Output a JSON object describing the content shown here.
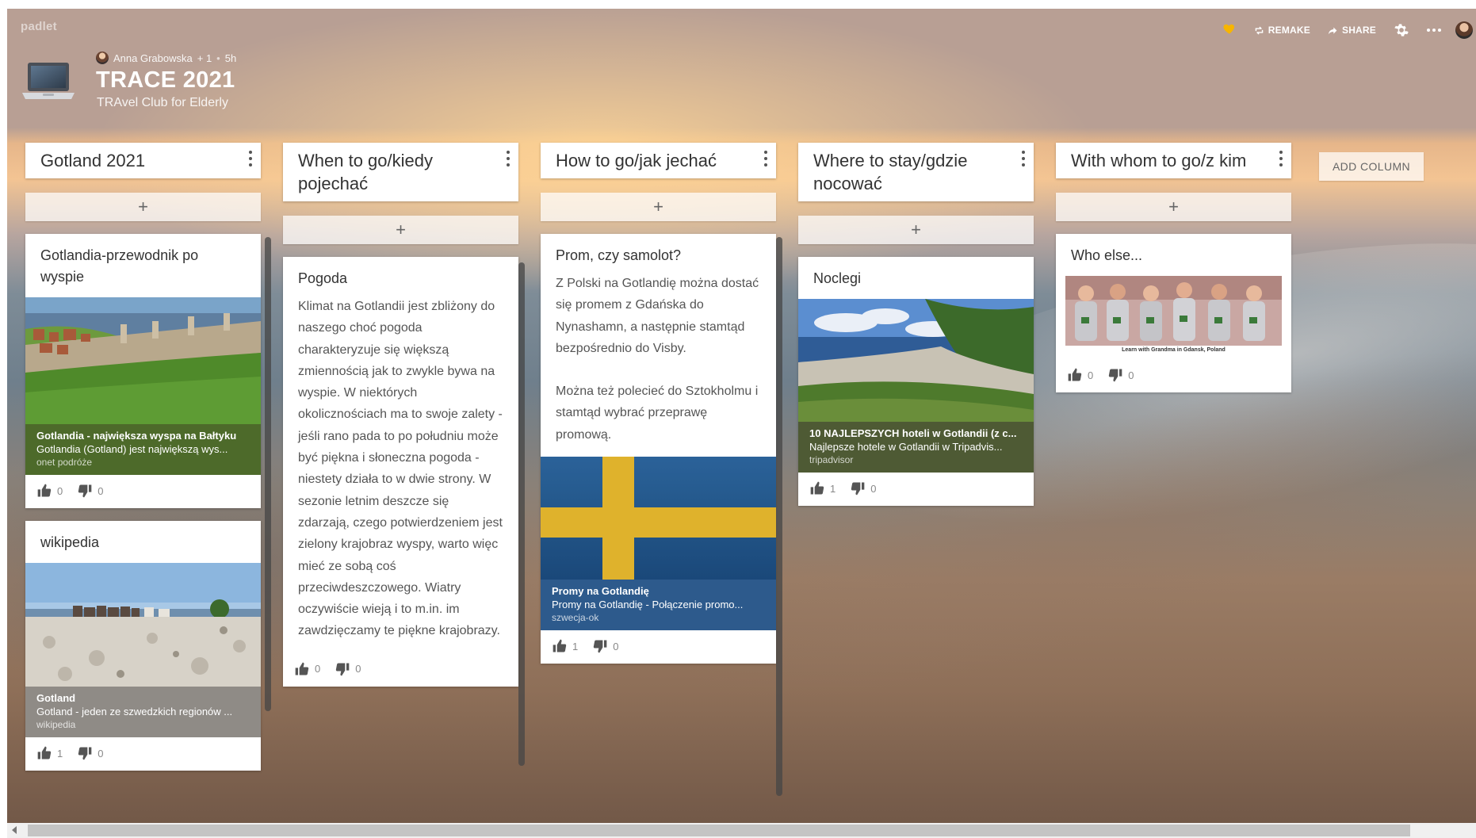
{
  "app": {
    "brand": "padlet",
    "toolbar": {
      "remake_label": "REMAKE",
      "share_label": "SHARE"
    },
    "icons": {
      "favorite": "heart-icon",
      "remake": "remake-icon",
      "share": "share-icon",
      "settings": "gear-icon",
      "more": "more-icon"
    },
    "accent_color": "#f7b500"
  },
  "board": {
    "author": "Anna Grabowska",
    "collaborators": "+ 1",
    "separator": "•",
    "time": "5h",
    "title": "TRACE 2021",
    "subtitle": "TRAvel Club for Elderly",
    "add_column_label": "ADD COLUMN",
    "add_post_label": "+"
  },
  "columns": [
    {
      "title": "Gotland 2021",
      "posts": [
        {
          "title": "Gotlandia-przewodnik po wyspie",
          "attachment": {
            "title": "Gotlandia - największa wyspa na Bałtyku",
            "desc": "Gotlandia (Gotland) jest największą wys...",
            "source": "onet podróże",
            "color": "#4d6a2a"
          },
          "likes": "0",
          "dislikes": "0"
        },
        {
          "title": "wikipedia",
          "attachment": {
            "title": "Gotland",
            "desc": "Gotland - jeden ze szwedzkich regionów ...",
            "source": "wikipedia",
            "color": "#8f8b86"
          },
          "likes": "1",
          "dislikes": "0"
        }
      ]
    },
    {
      "title": "When to go/kiedy pojechać",
      "posts": [
        {
          "title": "Pogoda",
          "body": "Klimat na Gotlandii jest zbliżony do naszego choć pogoda charakteryzuje się większą zmiennością jak to zwykle bywa na wyspie. W niektórych okolicznościach ma to swoje zalety - jeśli rano pada to po południu może być piękna i słoneczna pogoda - niestety działa to w dwie strony. W sezonie letnim deszcze się zdarzają, czego potwierdzeniem jest zielony krajobraz wyspy, warto więc mieć ze sobą coś przeciwdeszczowego. Wiatry oczywiście wieją i to m.in. im zawdzięczamy te piękne krajobrazy.",
          "likes": "0",
          "dislikes": "0"
        }
      ]
    },
    {
      "title": "How to go/jak jechać",
      "posts": [
        {
          "title": "Prom, czy samolot?",
          "body1": "Z Polski na Gotlandię można dostać się promem z Gdańska do Nynashamn, a następnie stamtąd bezpośrednio do Visby.",
          "body2": "Można też polecieć do Sztokholmu i stamtąd wybrać przeprawę promową.",
          "attachment": {
            "title": "Promy na Gotlandię",
            "desc": "Promy na Gotlandię - Połączenie promo...",
            "source": "szwecja-ok",
            "color": "#2d5a8c"
          },
          "likes": "1",
          "dislikes": "0"
        }
      ]
    },
    {
      "title": "Where to stay/gdzie nocować",
      "posts": [
        {
          "title": "Noclegi",
          "attachment": {
            "title": "10 NAJLEPSZYCH hoteli w Gotlandii (z c...",
            "desc": "Najlepsze hotele w Gotlandii w Tripadvis...",
            "source": "tripadvisor",
            "color": "#4e5a34"
          },
          "likes": "1",
          "dislikes": "0"
        }
      ]
    },
    {
      "title": "With whom to go/z kim",
      "posts": [
        {
          "title": "Who else...",
          "image_caption": "Learn with Grandma in Gdansk, Poland",
          "likes": "0",
          "dislikes": "0"
        }
      ]
    }
  ]
}
